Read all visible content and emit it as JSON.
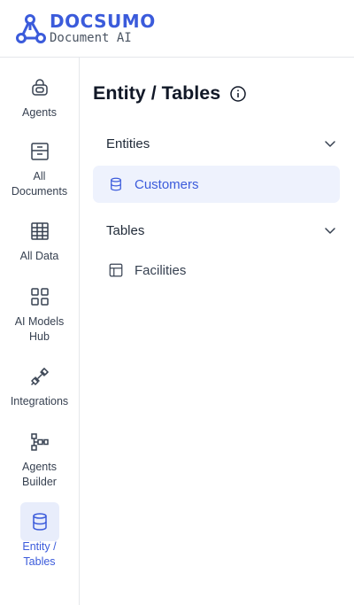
{
  "brand": {
    "name": "DOCSUMO",
    "tagline": "Document AI",
    "accent_color": "#3b5bdb"
  },
  "sidebar": {
    "items": [
      {
        "label": "Agents",
        "icon": "agent-icon",
        "active": false
      },
      {
        "label": "All Documents",
        "icon": "archive-icon",
        "active": false
      },
      {
        "label": "All Data",
        "icon": "table-grid-icon",
        "active": false
      },
      {
        "label": "AI Models Hub",
        "icon": "apps-grid-icon",
        "active": false
      },
      {
        "label": "Integrations",
        "icon": "plug-icon",
        "active": false
      },
      {
        "label": "Agents Builder",
        "icon": "workflow-icon",
        "active": false
      },
      {
        "label": "Entity / Tables",
        "icon": "database-icon",
        "active": true
      }
    ]
  },
  "main": {
    "title": "Entity / Tables",
    "sections": [
      {
        "title": "Entities",
        "expanded": true,
        "items": [
          {
            "label": "Customers",
            "icon": "database-icon",
            "active": true
          }
        ]
      },
      {
        "title": "Tables",
        "expanded": true,
        "items": [
          {
            "label": "Facilities",
            "icon": "table-icon",
            "active": false
          }
        ]
      }
    ]
  }
}
